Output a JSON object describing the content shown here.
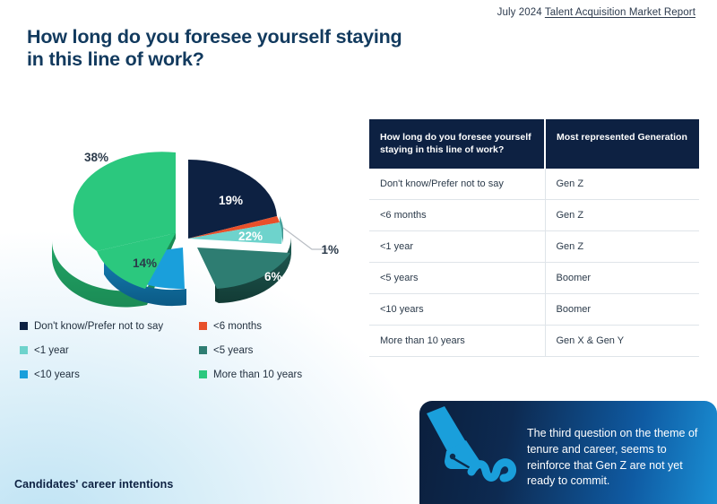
{
  "header": {
    "date": "July 2024",
    "report_link": "Talent Acquisition Market Report"
  },
  "slide": {
    "title": "How long do you foresee yourself staying in this line of work?",
    "footer": "Candidates' career intentions"
  },
  "chart_data": {
    "type": "pie",
    "title": "How long do you foresee yourself staying in this line of work?",
    "legend_position": "bottom-left",
    "labels": [
      "Don't know/Prefer not to say",
      "<6 months",
      "<1 year",
      "<5 years",
      "<10 years",
      "More than 10 years"
    ],
    "values": [
      19,
      1,
      6,
      22,
      14,
      38
    ],
    "value_labels": [
      "19%",
      "1%",
      "6%",
      "22%",
      "14%",
      "38%"
    ],
    "colors": [
      "#0d2142",
      "#e8502a",
      "#6ed3cc",
      "#2e7d72",
      "#1a9fdb",
      "#2bc87e"
    ],
    "exploded": [
      false,
      false,
      false,
      true,
      true,
      true
    ],
    "three_d": true
  },
  "legend": {
    "items": [
      {
        "label": "Don't know/Prefer not to say",
        "color": "#0d2142"
      },
      {
        "label": "<6 months",
        "color": "#e8502a"
      },
      {
        "label": "<1 year",
        "color": "#6ed3cc"
      },
      {
        "label": "<5 years",
        "color": "#2e7d72"
      },
      {
        "label": "<10 years",
        "color": "#1a9fdb"
      },
      {
        "label": "More than 10 years",
        "color": "#2bc87e"
      }
    ]
  },
  "table": {
    "headers": [
      "How long do you foresee yourself staying in this line of work?",
      "Most represented Generation"
    ],
    "rows": [
      [
        "Don't know/Prefer not to say",
        "Gen Z"
      ],
      [
        "<6 months",
        "Gen Z"
      ],
      [
        "<1 year",
        "Gen Z"
      ],
      [
        "<5 years",
        "Boomer"
      ],
      [
        "<10 years",
        "Boomer"
      ],
      [
        "More than 10 years",
        "Gen X & Gen Y"
      ]
    ]
  },
  "callout": {
    "icon": "signature-pen-icon",
    "text": "The third question on the theme of tenure and career, seems to reinforce that Gen Z are not yet ready to commit."
  }
}
